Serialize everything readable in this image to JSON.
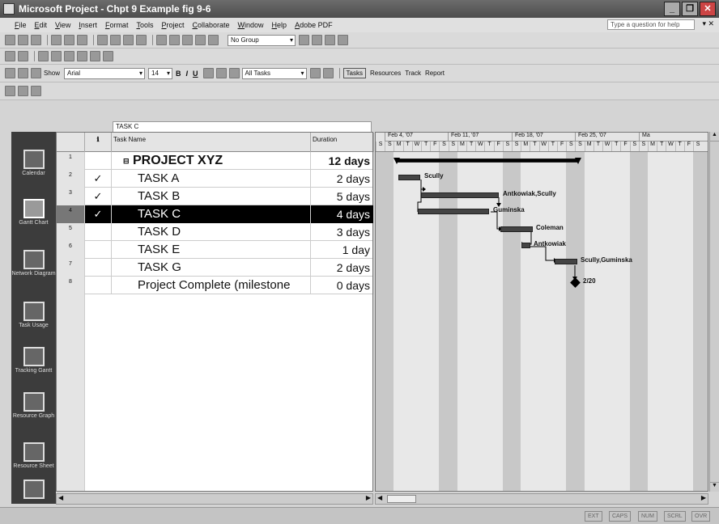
{
  "window": {
    "title": "Microsoft Project - Chpt 9 Example fig 9-6"
  },
  "menu": [
    "File",
    "Edit",
    "View",
    "Insert",
    "Format",
    "Tools",
    "Project",
    "Collaborate",
    "Window",
    "Help",
    "Adobe PDF"
  ],
  "help": {
    "placeholder": "Type a question for help"
  },
  "toolbar": {
    "group": "No Group",
    "show": "Show",
    "font": "Arial",
    "size": "14",
    "filter": "All Tasks",
    "tasks": "Tasks",
    "resources": "Resources",
    "track": "Track",
    "report": "Report"
  },
  "entry_bar": {
    "value": "TASK C"
  },
  "view_bar": [
    {
      "label": "Calendar",
      "icon": "calendar-icon"
    },
    {
      "label": "Gantt Chart",
      "icon": "gantt-icon"
    },
    {
      "label": "Network Diagram",
      "icon": "network-icon"
    },
    {
      "label": "Task Usage",
      "icon": "task-usage-icon"
    },
    {
      "label": "Tracking Gantt",
      "icon": "tracking-gantt-icon"
    },
    {
      "label": "Resource Graph",
      "icon": "resource-graph-icon"
    },
    {
      "label": "Resource Sheet",
      "icon": "resource-sheet-icon"
    }
  ],
  "grid": {
    "columns": {
      "indicators": "ℹ",
      "name": "Task Name",
      "duration": "Duration"
    },
    "rows": [
      {
        "id": "1",
        "check": "",
        "name": "PROJECT XYZ",
        "duration": "12 days",
        "collapse": "⊟"
      },
      {
        "id": "2",
        "check": "✓",
        "name": "TASK A",
        "duration": "2 days"
      },
      {
        "id": "3",
        "check": "✓",
        "name": "TASK B",
        "duration": "5 days"
      },
      {
        "id": "4",
        "check": "✓",
        "name": "TASK C",
        "duration": "4 days"
      },
      {
        "id": "5",
        "check": "",
        "name": "TASK D",
        "duration": "3 days"
      },
      {
        "id": "6",
        "check": "",
        "name": "TASK E",
        "duration": "1 day"
      },
      {
        "id": "7",
        "check": "",
        "name": "TASK G",
        "duration": "2 days"
      },
      {
        "id": "8",
        "check": "",
        "name": "Project Complete (milestone",
        "duration": "0 days"
      }
    ]
  },
  "timescale": {
    "weeks": [
      "Feb 4, '07",
      "Feb 11, '07",
      "Feb 18, '07",
      "Feb 25, '07",
      "Ma"
    ],
    "days": [
      "S",
      "S",
      "M",
      "T",
      "W",
      "T",
      "F",
      "S",
      "S",
      "M",
      "T",
      "W",
      "T",
      "F",
      "S",
      "S",
      "M",
      "T",
      "W",
      "T",
      "F",
      "S",
      "S",
      "M",
      "T",
      "W",
      "T",
      "F",
      "S",
      "S",
      "M",
      "T",
      "W",
      "T",
      "F",
      "S"
    ]
  },
  "gantt": {
    "labels": {
      "task_a": "Scully",
      "task_b": "Antkowiak,Scully",
      "task_c": "Guminska",
      "task_d": "Coleman",
      "task_e": "Antkowiak",
      "task_g": "Scully,Guminska",
      "milestone": "2/20"
    }
  },
  "status": [
    "EXT",
    "CAPS",
    "NUM",
    "SCRL",
    "OVR"
  ]
}
